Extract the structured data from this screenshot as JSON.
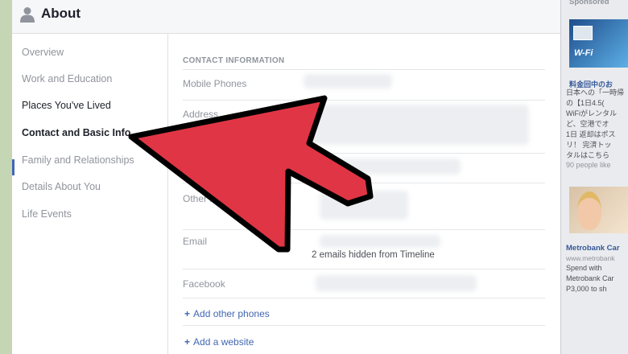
{
  "header": {
    "title": "About"
  },
  "nav": {
    "items": [
      {
        "label": "Overview"
      },
      {
        "label": "Work and Education"
      },
      {
        "label": "Places You've Lived"
      },
      {
        "label": "Contact and Basic Info"
      },
      {
        "label": "Family and Relationships"
      },
      {
        "label": "Details About You"
      },
      {
        "label": "Life Events"
      }
    ],
    "active_index": 3
  },
  "contact": {
    "heading": "CONTACT INFORMATION",
    "fields": {
      "mobile_phones": "Mobile Phones",
      "address": "Address",
      "other": "Other P",
      "email": "Email",
      "facebook": "Facebook"
    },
    "email_hidden_note": "2 emails hidden from Timeline",
    "add_phones": "Add other phones",
    "add_website": "Add a website",
    "plus": "+"
  },
  "sidebar": {
    "sponsored": "Sponsored",
    "ad1": {
      "image_text": "W-Fi",
      "title": "料金回中のお",
      "lines": [
        "日本への「一時帰",
        "の【1日4.5(",
        "WiFiがレンタル",
        "ど、空港でオ",
        "1日 返却はポス",
        "リ！ 完済トッ",
        "タルはこちら"
      ],
      "likes": "90 people like"
    },
    "ad2": {
      "title": "Metrobank Car",
      "url": "www.metrobank",
      "lines": [
        "Spend with",
        "Metrobank Car",
        "P3,000 to sh"
      ]
    }
  },
  "colors": {
    "accent": "#4267b2",
    "link": "#365899",
    "arrow_fill": "#e03545",
    "outer_bg": "#c5d6b4"
  }
}
